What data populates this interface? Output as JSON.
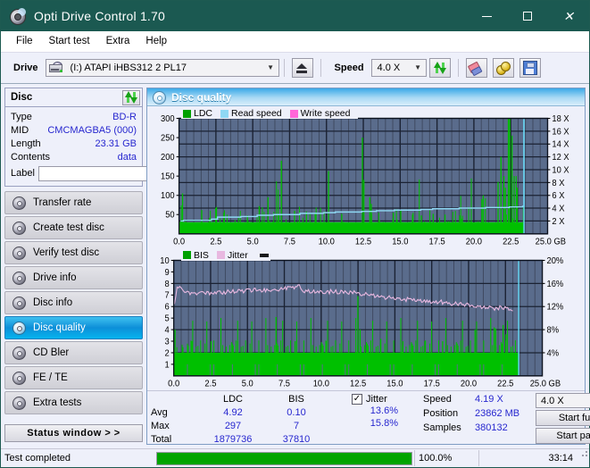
{
  "window": {
    "title": "Opti Drive Control 1.70",
    "icon": "disc-icon",
    "minimize": "–",
    "maximize": "□",
    "close": "✕"
  },
  "menu": {
    "items": [
      "File",
      "Start test",
      "Extra",
      "Help"
    ]
  },
  "toolbar": {
    "drive_label": "Drive",
    "drive_value": "(I:)  ATAPI iHBS312   2 PL17",
    "eject_icon": "eject-icon",
    "speed_label": "Speed",
    "speed_value": "4.0 X",
    "refresh_icon": "refresh-icon",
    "erase_icon": "eraser-icon",
    "coins_icon": "coins-icon",
    "save_icon": "floppy-save-icon",
    "dropdown_arrow": "⌄"
  },
  "disc_panel": {
    "title": "Disc",
    "refresh_icon": "refresh-icon",
    "rows": [
      {
        "key": "Type",
        "value": "BD-R"
      },
      {
        "key": "MID",
        "value": "CMCMAGBA5 (000)"
      },
      {
        "key": "Length",
        "value": "23.31 GB"
      },
      {
        "key": "Contents",
        "value": "data"
      }
    ],
    "label_key": "Label",
    "label_value": "",
    "label_placeholder": "",
    "cd_icon": "cd-icon"
  },
  "nav": {
    "items": [
      {
        "label": "Transfer rate",
        "active": false
      },
      {
        "label": "Create test disc",
        "active": false
      },
      {
        "label": "Verify test disc",
        "active": false
      },
      {
        "label": "Drive info",
        "active": false
      },
      {
        "label": "Disc info",
        "active": false
      },
      {
        "label": "Disc quality",
        "active": true
      },
      {
        "label": "CD Bler",
        "active": false
      },
      {
        "label": "FE / TE",
        "active": false
      },
      {
        "label": "Extra tests",
        "active": false
      }
    ],
    "status_button": "Status window > >"
  },
  "panel": {
    "title": "Disc quality",
    "icon": "disc-quality-icon"
  },
  "stats": {
    "col_headers": [
      "",
      "LDC",
      "BIS"
    ],
    "rows": [
      {
        "key": "Avg",
        "ldc": "4.92",
        "bis": "0.10"
      },
      {
        "key": "Max",
        "ldc": "297",
        "bis": "7"
      },
      {
        "key": "Total",
        "ldc": "1879736",
        "bis": "37810"
      }
    ],
    "jitter_label": "Jitter",
    "jitter_checked": true,
    "jitter_avg": "13.6%",
    "jitter_max": "15.8%",
    "speed_label": "Speed",
    "speed_value": "4.19 X",
    "position_label": "Position",
    "position_value": "23862 MB",
    "samples_label": "Samples",
    "samples_value": "380132",
    "speed_select": "4.0 X",
    "start_full": "Start full",
    "start_part": "Start part"
  },
  "statusbar": {
    "text": "Test completed",
    "progress_pct": "100.0%",
    "progress_value": 100,
    "elapsed": "33:14"
  },
  "colors": {
    "title_bg": "#1b5951",
    "ldc_green": "#00c000",
    "read_speed_blue": "#8fd8f4",
    "write_speed_pink": "#ff66d9",
    "jitter_pink": "#e8b8e0",
    "plot_bg": "#5a6c8c",
    "grid": "#2b3448",
    "value_blue": "#2727cf",
    "progress_green": "#00a400",
    "active_nav": "#0d8fd8"
  },
  "chart_data": [
    {
      "type": "line",
      "id": "ldc-chart",
      "title": "",
      "legend": [
        {
          "label": "LDC",
          "color": "#00a000",
          "swatch": "ldc-swatch"
        },
        {
          "label": "Read speed",
          "color": "#8fd8f4",
          "swatch": "read-speed-swatch"
        },
        {
          "label": "Write speed",
          "color": "#ff66d9",
          "swatch": "write-speed-swatch"
        }
      ],
      "legend_position": "top-left",
      "grid": true,
      "xlabel": "GB",
      "ylabel": "",
      "xlim": [
        0,
        25.0
      ],
      "ylim": [
        0,
        300
      ],
      "xticks": [
        0.0,
        2.5,
        5.0,
        7.5,
        10.0,
        12.5,
        15.0,
        17.5,
        20.0,
        22.5,
        25.0
      ],
      "xticklabels": [
        "0.0",
        "2.5",
        "5.0",
        "7.5",
        "10.0",
        "12.5",
        "15.0",
        "17.5",
        "20.0",
        "22.5",
        "25.0 GB"
      ],
      "yticks": [
        50,
        100,
        150,
        200,
        250,
        300
      ],
      "yticklabels": [
        "50",
        "100",
        "150",
        "200",
        "250",
        "300"
      ],
      "y2label": "X",
      "y2lim": [
        0,
        18
      ],
      "y2ticks": [
        2,
        4,
        6,
        8,
        10,
        12,
        14,
        16,
        18
      ],
      "y2ticklabels": [
        "2 X",
        "4 X",
        "6 X",
        "8 X",
        "10 X",
        "12 X",
        "14 X",
        "16 X",
        "18 X"
      ],
      "series": [
        {
          "name": "LDC",
          "color": "#00c000",
          "style": "vertical-bars",
          "note": "dense noisy baseline ~20-50 with tall spikes; largest spikes near 0.2 (105), 6.9 (190), 10.1 (163), 12.5 (250), 20.6 (145), 21.8 (230), 22.4 (300), 22.6 (255)",
          "baseline": 30,
          "x_end": 23.4
        },
        {
          "name": "Read speed",
          "color": "#8fd8f4",
          "style": "step-line",
          "axis": "right",
          "points": [
            [
              0.1,
              2.0
            ],
            [
              0.3,
              2.1
            ],
            [
              2.2,
              2.3
            ],
            [
              2.6,
              2.6
            ],
            [
              4.2,
              2.7
            ],
            [
              5.3,
              2.9
            ],
            [
              6.4,
              3.0
            ],
            [
              8.2,
              3.2
            ],
            [
              9.8,
              3.3
            ],
            [
              10.6,
              3.4
            ],
            [
              12.4,
              3.5
            ],
            [
              13.4,
              3.6
            ],
            [
              14.6,
              3.7
            ],
            [
              16.4,
              3.8
            ],
            [
              17.2,
              3.9
            ],
            [
              19.0,
              4.0
            ],
            [
              20.8,
              4.1
            ],
            [
              22.4,
              4.2
            ],
            [
              23.3,
              4.3
            ],
            [
              23.4,
              18.0
            ]
          ]
        },
        {
          "name": "Write speed",
          "color": "#ff66d9",
          "style": "line",
          "points": []
        }
      ]
    },
    {
      "type": "line",
      "id": "bis-jitter-chart",
      "title": "",
      "legend": [
        {
          "label": "BIS",
          "color": "#00a000",
          "swatch": "bis-swatch"
        },
        {
          "label": "Jitter",
          "color": "#e8b8e0",
          "swatch": "jitter-swatch"
        }
      ],
      "legend_position": "top-left",
      "grid": true,
      "xlabel": "GB",
      "ylabel": "",
      "xlim": [
        0,
        25.0
      ],
      "ylim": [
        0,
        10
      ],
      "xticks": [
        0.0,
        2.5,
        5.0,
        7.5,
        10.0,
        12.5,
        15.0,
        17.5,
        20.0,
        22.5,
        25.0
      ],
      "xticklabels": [
        "0.0",
        "2.5",
        "5.0",
        "7.5",
        "10.0",
        "12.5",
        "15.0",
        "17.5",
        "20.0",
        "22.5",
        "25.0 GB"
      ],
      "yticks": [
        1,
        2,
        3,
        4,
        5,
        6,
        7,
        8,
        9,
        10
      ],
      "yticklabels": [
        "1",
        "2",
        "3",
        "4",
        "5",
        "6",
        "7",
        "8",
        "9",
        "10"
      ],
      "y2label": "%",
      "y2lim": [
        0,
        20
      ],
      "y2ticks": [
        4,
        8,
        12,
        16,
        20
      ],
      "y2ticklabels": [
        "4%",
        "8%",
        "12%",
        "16%",
        "20%"
      ],
      "series": [
        {
          "name": "BIS",
          "color": "#00c000",
          "style": "vertical-bars",
          "baseline": 2,
          "note": "solid green fill to ~2 with spikes to 3 and occasional 4-5; spike 5.1 near x=6.9; 6.9 near x=12.5",
          "x_end": 23.4
        },
        {
          "name": "Jitter",
          "color": "#e8b8e0",
          "style": "line",
          "axis": "right",
          "note": "starts ~12.8%, rises to ~15%, plateau ~14.5-15.5% to x=8.5, then gradual decline to ~11.5% at x=23",
          "points": [
            [
              0.05,
              12.4
            ],
            [
              0.25,
              15.5
            ],
            [
              0.8,
              14.4
            ],
            [
              1.6,
              14.3
            ],
            [
              2.6,
              14.4
            ],
            [
              3.5,
              14.5
            ],
            [
              4.4,
              14.6
            ],
            [
              5.4,
              14.8
            ],
            [
              6.3,
              14.9
            ],
            [
              7.2,
              15.0
            ],
            [
              8.0,
              15.2
            ],
            [
              8.5,
              15.6
            ],
            [
              8.8,
              14.6
            ],
            [
              9.8,
              14.5
            ],
            [
              10.8,
              14.6
            ],
            [
              11.8,
              14.5
            ],
            [
              12.6,
              14.3
            ],
            [
              13.4,
              14.0
            ],
            [
              14.2,
              13.6
            ],
            [
              15.0,
              13.4
            ],
            [
              16.0,
              13.2
            ],
            [
              17.0,
              13.0
            ],
            [
              18.0,
              12.8
            ],
            [
              19.0,
              12.5
            ],
            [
              20.0,
              12.2
            ],
            [
              21.0,
              11.9
            ],
            [
              21.8,
              11.7
            ],
            [
              22.4,
              11.8
            ],
            [
              23.0,
              11.5
            ]
          ]
        }
      ]
    }
  ]
}
